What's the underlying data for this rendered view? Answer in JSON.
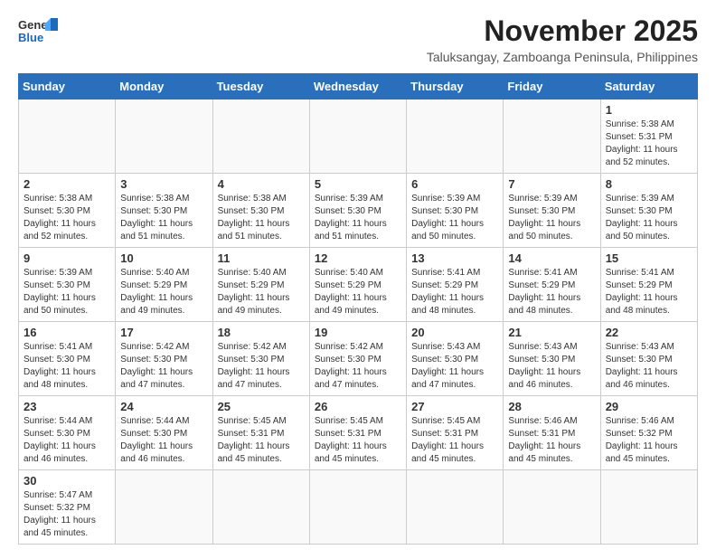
{
  "header": {
    "logo_line1": "General",
    "logo_line2": "Blue",
    "month_title": "November 2025",
    "subtitle": "Taluksangay, Zamboanga Peninsula, Philippines"
  },
  "weekdays": [
    "Sunday",
    "Monday",
    "Tuesday",
    "Wednesday",
    "Thursday",
    "Friday",
    "Saturday"
  ],
  "weeks": [
    [
      {
        "day": "",
        "info": ""
      },
      {
        "day": "",
        "info": ""
      },
      {
        "day": "",
        "info": ""
      },
      {
        "day": "",
        "info": ""
      },
      {
        "day": "",
        "info": ""
      },
      {
        "day": "",
        "info": ""
      },
      {
        "day": "1",
        "info": "Sunrise: 5:38 AM\nSunset: 5:31 PM\nDaylight: 11 hours\nand 52 minutes."
      }
    ],
    [
      {
        "day": "2",
        "info": "Sunrise: 5:38 AM\nSunset: 5:30 PM\nDaylight: 11 hours\nand 52 minutes."
      },
      {
        "day": "3",
        "info": "Sunrise: 5:38 AM\nSunset: 5:30 PM\nDaylight: 11 hours\nand 51 minutes."
      },
      {
        "day": "4",
        "info": "Sunrise: 5:38 AM\nSunset: 5:30 PM\nDaylight: 11 hours\nand 51 minutes."
      },
      {
        "day": "5",
        "info": "Sunrise: 5:39 AM\nSunset: 5:30 PM\nDaylight: 11 hours\nand 51 minutes."
      },
      {
        "day": "6",
        "info": "Sunrise: 5:39 AM\nSunset: 5:30 PM\nDaylight: 11 hours\nand 50 minutes."
      },
      {
        "day": "7",
        "info": "Sunrise: 5:39 AM\nSunset: 5:30 PM\nDaylight: 11 hours\nand 50 minutes."
      },
      {
        "day": "8",
        "info": "Sunrise: 5:39 AM\nSunset: 5:30 PM\nDaylight: 11 hours\nand 50 minutes."
      }
    ],
    [
      {
        "day": "9",
        "info": "Sunrise: 5:39 AM\nSunset: 5:30 PM\nDaylight: 11 hours\nand 50 minutes."
      },
      {
        "day": "10",
        "info": "Sunrise: 5:40 AM\nSunset: 5:29 PM\nDaylight: 11 hours\nand 49 minutes."
      },
      {
        "day": "11",
        "info": "Sunrise: 5:40 AM\nSunset: 5:29 PM\nDaylight: 11 hours\nand 49 minutes."
      },
      {
        "day": "12",
        "info": "Sunrise: 5:40 AM\nSunset: 5:29 PM\nDaylight: 11 hours\nand 49 minutes."
      },
      {
        "day": "13",
        "info": "Sunrise: 5:41 AM\nSunset: 5:29 PM\nDaylight: 11 hours\nand 48 minutes."
      },
      {
        "day": "14",
        "info": "Sunrise: 5:41 AM\nSunset: 5:29 PM\nDaylight: 11 hours\nand 48 minutes."
      },
      {
        "day": "15",
        "info": "Sunrise: 5:41 AM\nSunset: 5:29 PM\nDaylight: 11 hours\nand 48 minutes."
      }
    ],
    [
      {
        "day": "16",
        "info": "Sunrise: 5:41 AM\nSunset: 5:30 PM\nDaylight: 11 hours\nand 48 minutes."
      },
      {
        "day": "17",
        "info": "Sunrise: 5:42 AM\nSunset: 5:30 PM\nDaylight: 11 hours\nand 47 minutes."
      },
      {
        "day": "18",
        "info": "Sunrise: 5:42 AM\nSunset: 5:30 PM\nDaylight: 11 hours\nand 47 minutes."
      },
      {
        "day": "19",
        "info": "Sunrise: 5:42 AM\nSunset: 5:30 PM\nDaylight: 11 hours\nand 47 minutes."
      },
      {
        "day": "20",
        "info": "Sunrise: 5:43 AM\nSunset: 5:30 PM\nDaylight: 11 hours\nand 47 minutes."
      },
      {
        "day": "21",
        "info": "Sunrise: 5:43 AM\nSunset: 5:30 PM\nDaylight: 11 hours\nand 46 minutes."
      },
      {
        "day": "22",
        "info": "Sunrise: 5:43 AM\nSunset: 5:30 PM\nDaylight: 11 hours\nand 46 minutes."
      }
    ],
    [
      {
        "day": "23",
        "info": "Sunrise: 5:44 AM\nSunset: 5:30 PM\nDaylight: 11 hours\nand 46 minutes."
      },
      {
        "day": "24",
        "info": "Sunrise: 5:44 AM\nSunset: 5:30 PM\nDaylight: 11 hours\nand 46 minutes."
      },
      {
        "day": "25",
        "info": "Sunrise: 5:45 AM\nSunset: 5:31 PM\nDaylight: 11 hours\nand 45 minutes."
      },
      {
        "day": "26",
        "info": "Sunrise: 5:45 AM\nSunset: 5:31 PM\nDaylight: 11 hours\nand 45 minutes."
      },
      {
        "day": "27",
        "info": "Sunrise: 5:45 AM\nSunset: 5:31 PM\nDaylight: 11 hours\nand 45 minutes."
      },
      {
        "day": "28",
        "info": "Sunrise: 5:46 AM\nSunset: 5:31 PM\nDaylight: 11 hours\nand 45 minutes."
      },
      {
        "day": "29",
        "info": "Sunrise: 5:46 AM\nSunset: 5:32 PM\nDaylight: 11 hours\nand 45 minutes."
      }
    ],
    [
      {
        "day": "30",
        "info": "Sunrise: 5:47 AM\nSunset: 5:32 PM\nDaylight: 11 hours\nand 45 minutes."
      },
      {
        "day": "",
        "info": ""
      },
      {
        "day": "",
        "info": ""
      },
      {
        "day": "",
        "info": ""
      },
      {
        "day": "",
        "info": ""
      },
      {
        "day": "",
        "info": ""
      },
      {
        "day": "",
        "info": ""
      }
    ]
  ]
}
